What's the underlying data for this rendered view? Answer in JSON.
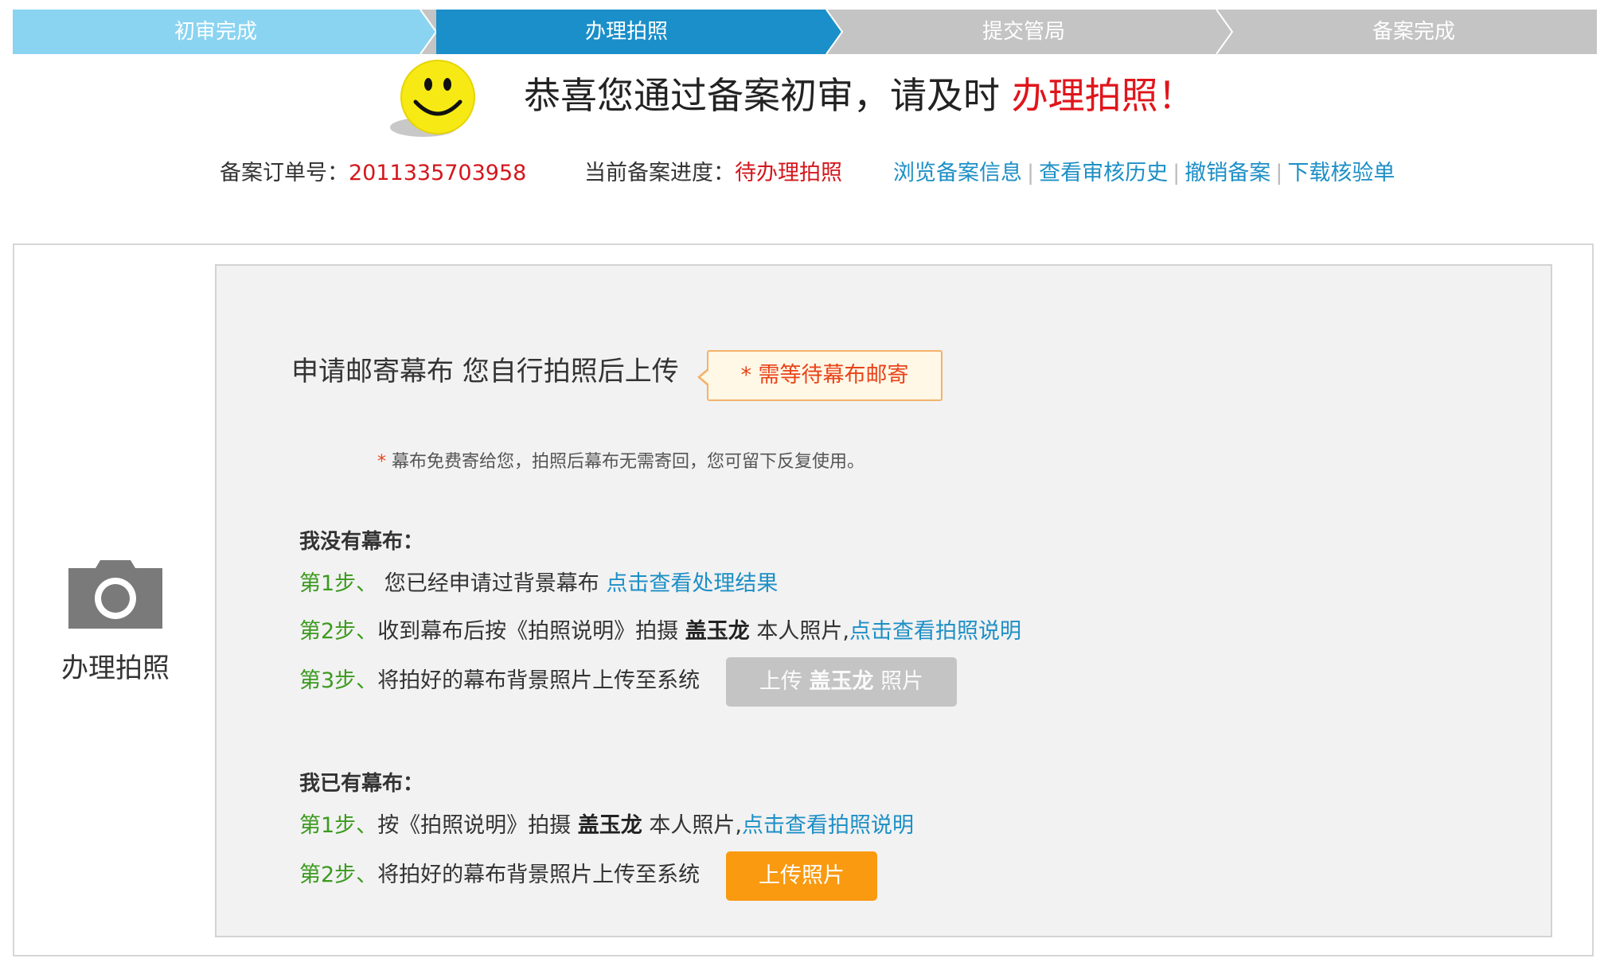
{
  "steps": [
    {
      "label": "初审完成",
      "state": "done"
    },
    {
      "label": "办理拍照",
      "state": "active"
    },
    {
      "label": "提交管局",
      "state": "todo"
    },
    {
      "label": "备案完成",
      "state": "todo"
    }
  ],
  "header": {
    "headline_main": "恭喜您通过备案初审，请及时",
    "headline_highlight": "办理拍照！"
  },
  "info": {
    "order_label": "备案订单号：",
    "order_value": "2011335703958",
    "progress_label": "当前备案进度：",
    "progress_value": "待办理拍照",
    "links": [
      "浏览备案信息",
      "查看审核历史",
      "撤销备案",
      "下载核验单"
    ]
  },
  "side": {
    "icon": "camera-icon",
    "label": "办理拍照"
  },
  "panel": {
    "title": "申请邮寄幕布 您自行拍照后上传",
    "tip": "需等待幕布邮寄",
    "note": "幕布免费寄给您，拍照后幕布无需寄回，您可留下反复使用。",
    "no_curtain": {
      "title": "我没有幕布：",
      "step1_no": "第1步、",
      "step1_text": " 您已经申请过背景幕布 ",
      "step1_link": "点击查看处理结果",
      "step2_no": "第2步、",
      "step2_pre": "收到幕布后按《拍照说明》拍摄 ",
      "step2_name": "盖玉龙",
      "step2_post": " 本人照片,",
      "step2_link": "点击查看拍照说明",
      "step3_no": "第3步、",
      "step3_text": "将拍好的幕布背景照片上传至系统",
      "button_pre": "上传 ",
      "button_name": "盖玉龙",
      "button_post": " 照片"
    },
    "has_curtain": {
      "title": "我已有幕布：",
      "step1_no": "第1步、",
      "step1_pre": "按《拍照说明》拍摄 ",
      "step1_name": "盖玉龙",
      "step1_post": " 本人照片,",
      "step1_link": "点击查看拍照说明",
      "step2_no": "第2步、",
      "step2_text": "将拍好的幕布背景照片上传至系统",
      "button": "上传照片"
    }
  },
  "colors": {
    "step_done": "#8ad4f1",
    "step_active": "#1a8fc9",
    "step_todo": "#c4c4c4",
    "link": "#1d8fc6",
    "highlight_red": "#e0151b",
    "step_green": "#3c9a1f",
    "button_orange": "#f99a11"
  }
}
